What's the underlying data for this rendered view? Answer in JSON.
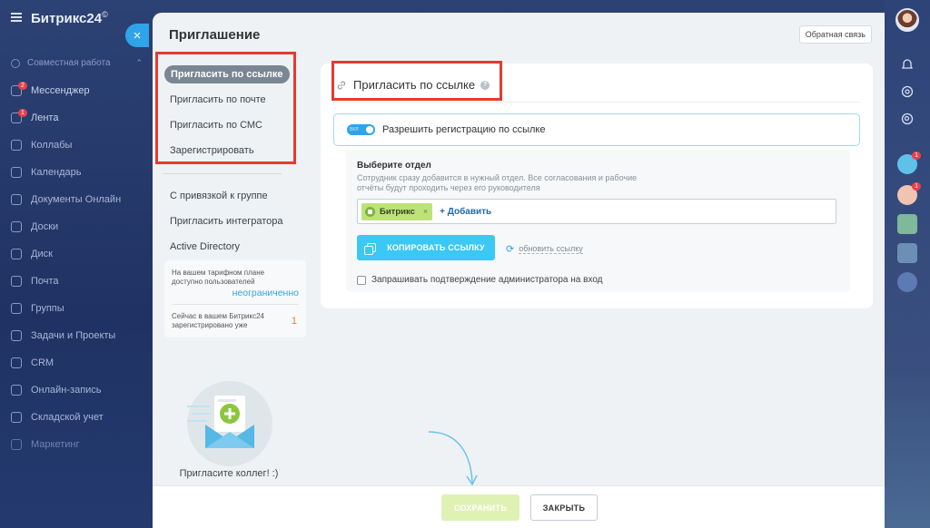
{
  "portal": {
    "brand": "Битрикс24",
    "brand_mark": "©",
    "group_label": "Совместная работа",
    "menu": [
      {
        "label": "Мессенджер",
        "badge": "2"
      },
      {
        "label": "Лента",
        "badge": "1"
      },
      {
        "label": "Коллабы",
        "badge": ""
      },
      {
        "label": "Календарь",
        "badge": ""
      },
      {
        "label": "Документы Онлайн",
        "badge": ""
      },
      {
        "label": "Доски",
        "badge": ""
      },
      {
        "label": "Диск",
        "badge": ""
      },
      {
        "label": "Почта",
        "badge": ""
      },
      {
        "label": "Группы",
        "badge": ""
      },
      {
        "label": "Задачи и Проекты",
        "badge": ""
      },
      {
        "label": "CRM",
        "badge": ""
      },
      {
        "label": "Онлайн-запись",
        "badge": ""
      },
      {
        "label": "Складской учет",
        "badge": ""
      },
      {
        "label": "Маркетинг",
        "badge": ""
      }
    ],
    "rail_badges": [
      "1",
      "1"
    ]
  },
  "panel": {
    "title": "Приглашение",
    "feedback": "Обратная связь",
    "close_symbol": "×",
    "nav": [
      {
        "label": "Пригласить по ссылке",
        "active": true
      },
      {
        "label": "Пригласить по почте",
        "active": false
      },
      {
        "label": "Пригласить по СМС",
        "active": false
      },
      {
        "label": "Зарегистрировать",
        "active": false
      }
    ],
    "nav_secondary": [
      {
        "label": "С привязкой к группе"
      },
      {
        "label": "Пригласить интегратора"
      },
      {
        "label": "Active Directory"
      }
    ],
    "tariff": {
      "plan_text": "На вашем тарифном плане доступно пользователей",
      "plan_value": "неограниченно",
      "registered_text": "Сейчас в вашем Битрикс24 зарегистрировано уже",
      "registered_value": "1"
    },
    "illustration_caption": "Пригласите коллег! :)"
  },
  "card": {
    "title": "Пригласить по ссылке",
    "help_symbol": "?",
    "toggle_state_label": "ВКЛ",
    "toggle_label": "Разрешить регистрацию по ссылке",
    "dept_title": "Выберите отдел",
    "dept_desc": "Сотрудник сразу добавится в нужный отдел. Все согласования и рабочие отчёты будут проходить через его руководителя",
    "tag": "Битрикс",
    "tag_remove": "×",
    "add_label": "+ Добавить",
    "copy_label": "КОПИРОВАТЬ ССЫЛКУ",
    "refresh_label": "обновить ссылку",
    "confirm_label": "Запрашивать подтверждение администратора на вход"
  },
  "footer": {
    "save": "СОХРАНИТЬ",
    "close": "ЗАКРЫТЬ"
  },
  "colors": {
    "accent": "#2fa4e9",
    "highlight": "#e53b2f",
    "copy_button": "#3bc8f5",
    "save_disabled": "#dff2b4"
  }
}
